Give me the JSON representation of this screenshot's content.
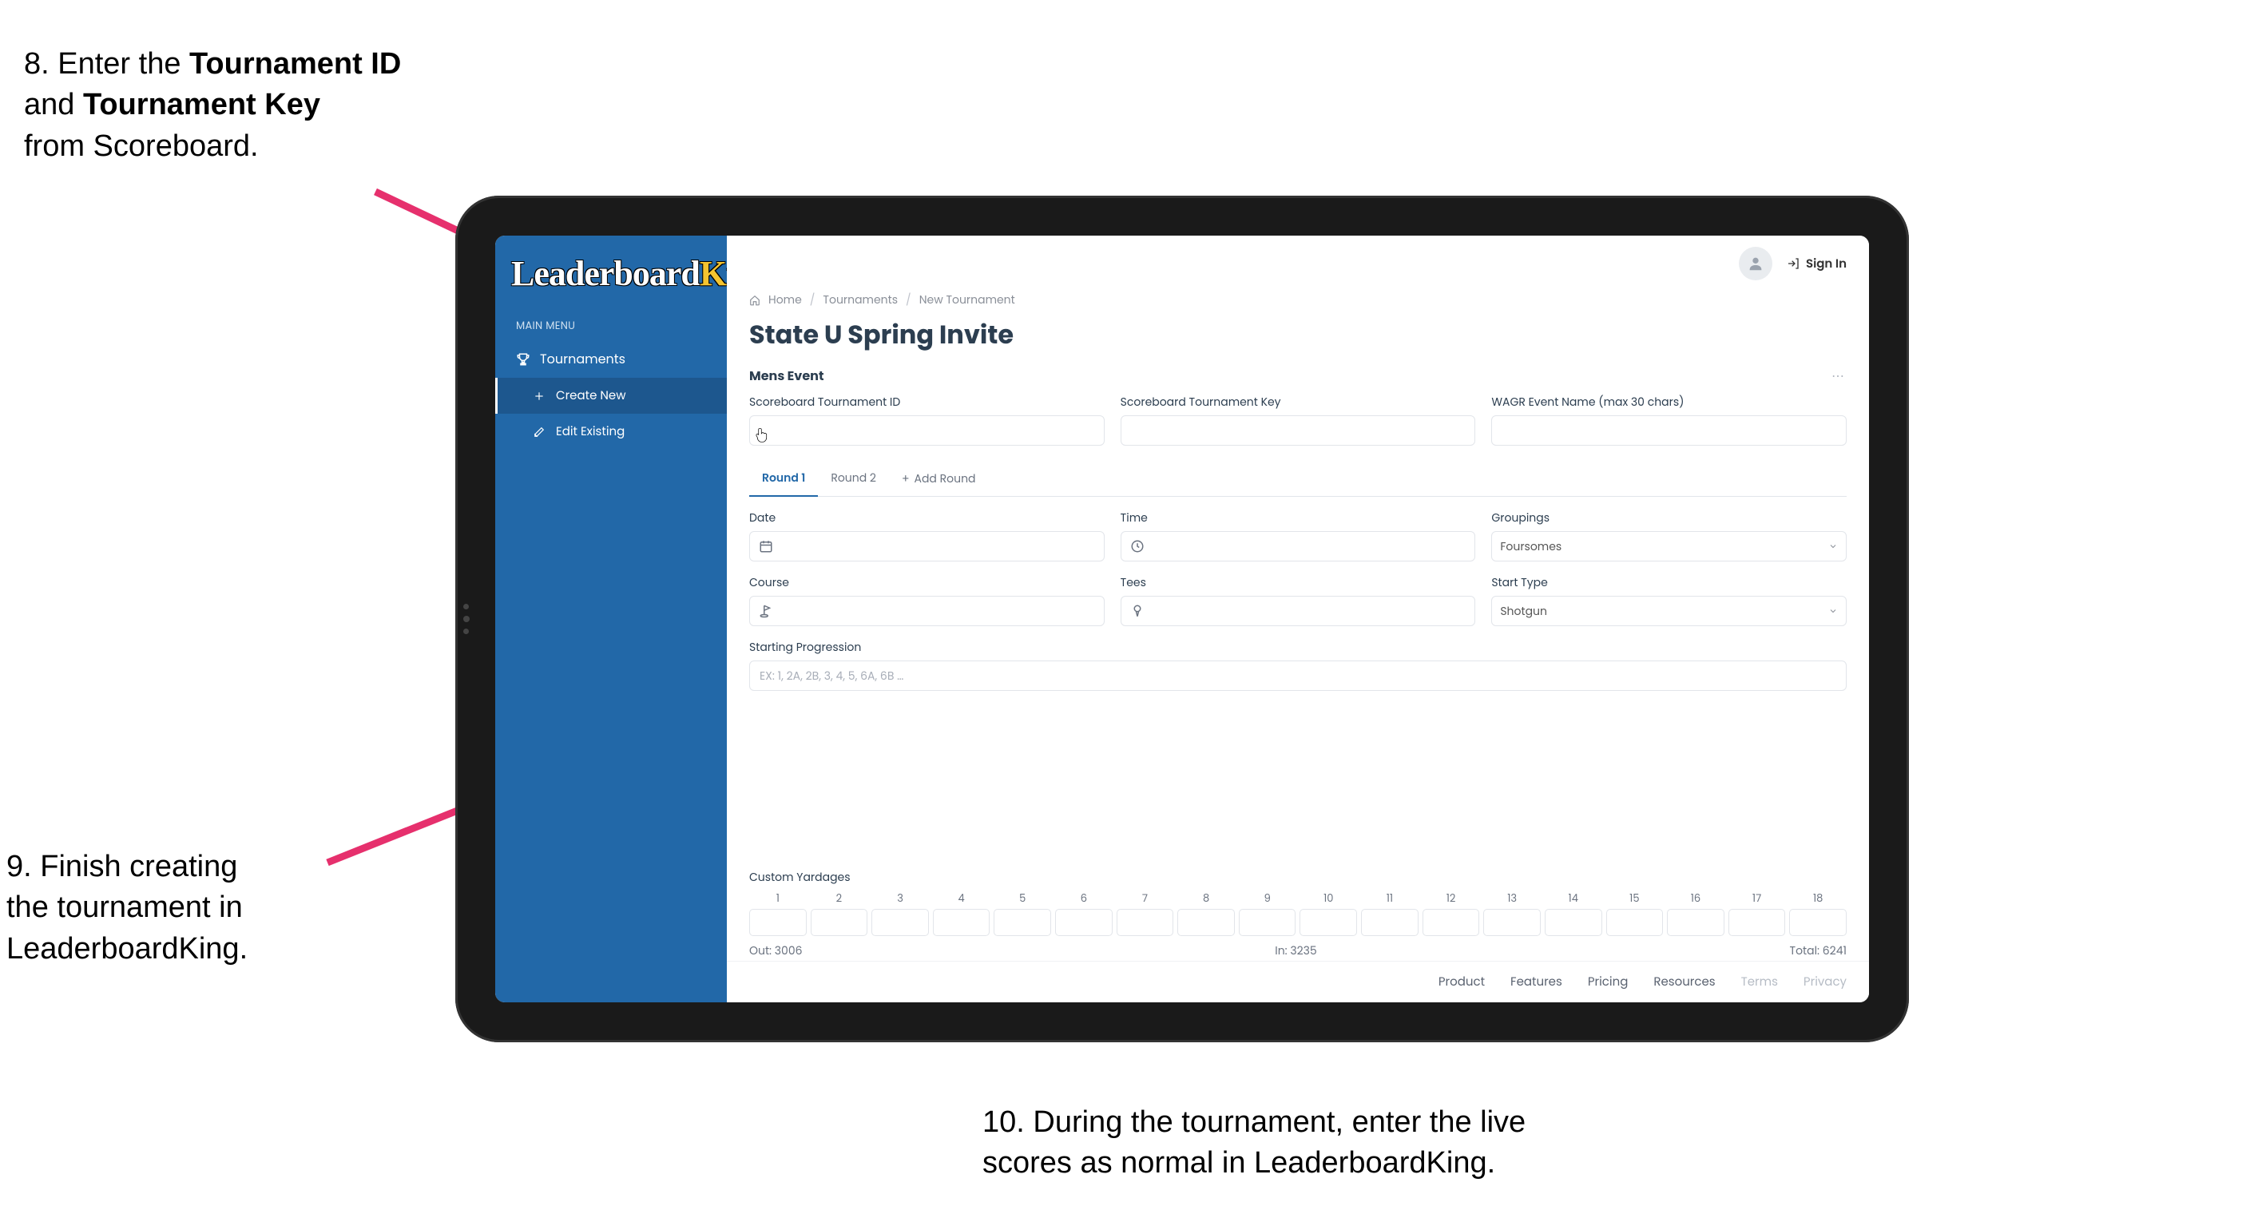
{
  "annotations": {
    "step8_line1_pre": "8. Enter the ",
    "step8_bold1": "Tournament ID",
    "step8_line2_pre": "and ",
    "step8_bold2": "Tournament Key",
    "step8_line3": "from Scoreboard.",
    "step9_line1": "9. Finish creating",
    "step9_line2": "the tournament in",
    "step9_line3": "LeaderboardKing.",
    "step10_line1": "10. During the tournament, enter the live",
    "step10_line2": "scores as normal in LeaderboardKing."
  },
  "colors": {
    "arrow": "#E6306D",
    "sidebar": "#2268A8"
  },
  "app": {
    "logo_a": "Leaderboard",
    "logo_b": "King",
    "menu_label": "MAIN MENU",
    "nav_tournaments": "Tournaments",
    "nav_create": "Create New",
    "nav_edit": "Edit Existing",
    "signin": "Sign In",
    "breadcrumb": {
      "home": "Home",
      "tournaments": "Tournaments",
      "new": "New Tournament"
    },
    "page_title": "State U Spring Invite",
    "section_title": "Mens Event",
    "fields": {
      "scoreboard_id": "Scoreboard Tournament ID",
      "scoreboard_key": "Scoreboard Tournament Key",
      "wagr": "WAGR Event Name (max 30 chars)",
      "date": "Date",
      "time": "Time",
      "groupings": "Groupings",
      "course": "Course",
      "tees": "Tees",
      "start_type": "Start Type",
      "starting_progression": "Starting Progression",
      "custom_yardages": "Custom Yardages"
    },
    "tabs": {
      "r1": "Round 1",
      "r2": "Round 2",
      "add": "Add Round"
    },
    "values": {
      "groupings_selected": "Foursomes",
      "start_type_selected": "Shotgun",
      "progression_placeholder": "EX: 1, 2A, 2B, 3, 4, 5, 6A, 6B …"
    },
    "holes": [
      "1",
      "2",
      "3",
      "4",
      "5",
      "6",
      "7",
      "8",
      "9",
      "10",
      "11",
      "12",
      "13",
      "14",
      "15",
      "16",
      "17",
      "18"
    ],
    "yardage_totals": {
      "out": "Out: 3006",
      "in": "In: 3235",
      "total": "Total: 6241"
    },
    "footer": {
      "product": "Product",
      "features": "Features",
      "pricing": "Pricing",
      "resources": "Resources",
      "terms": "Terms",
      "privacy": "Privacy"
    }
  }
}
